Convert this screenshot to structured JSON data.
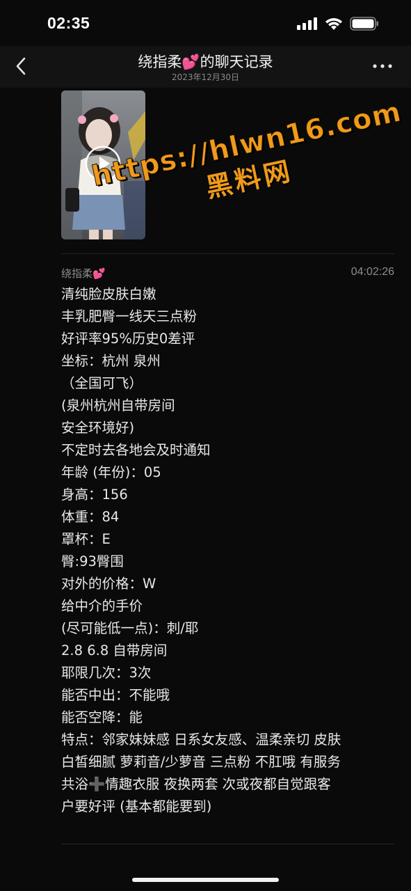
{
  "status_bar": {
    "time": "02:35",
    "icons": [
      "cellular-signal-icon",
      "wifi-icon",
      "battery-icon"
    ]
  },
  "header": {
    "title": "绕指柔💕的聊天记录",
    "date": "2023年12月30日",
    "back_icon": "chevron-left-icon",
    "more_icon": "ellipsis-icon"
  },
  "video": {
    "play_icon": "play-icon"
  },
  "watermark": {
    "url": "https://hlwn16.com",
    "site_name": "黑料网"
  },
  "message": {
    "sender": "绕指柔💕",
    "time": "04:02:26",
    "lines": [
      "清纯脸皮肤白嫩",
      "丰乳肥臀一线天三点粉",
      "好评率95%历史0差评",
      "坐标：杭州 泉州",
      "（全国可飞）",
      "(泉州杭州自带房间",
      "安全环境好)",
      "不定时去各地会及时通知",
      "年龄 (年份)：05",
      "身高：156",
      "体重：84",
      "罩杯：E",
      "臀:93臀围",
      "对外的价格：W",
      "给中介的手价",
      "(尽可能低一点)：刺/耶",
      "2.8   6.8  自带房间",
      "耶限几次：3次",
      "能否中出：不能哦",
      "能否空降：能",
      "特点：邻家妹妹感 日系女友感、温柔亲切  皮肤",
      "白皙细腻 萝莉音/少萝音   三点粉  不肛哦 有服务",
      "共浴➕情趣衣服  夜换两套  次或夜都自觉跟客",
      "户要好评 (基本都能要到)"
    ]
  },
  "colors": {
    "background": "#0a0a0a",
    "header_bg": "#131313",
    "text": "#e8e8e8",
    "muted": "#8d8d8d",
    "watermark": "#f09a1a"
  }
}
